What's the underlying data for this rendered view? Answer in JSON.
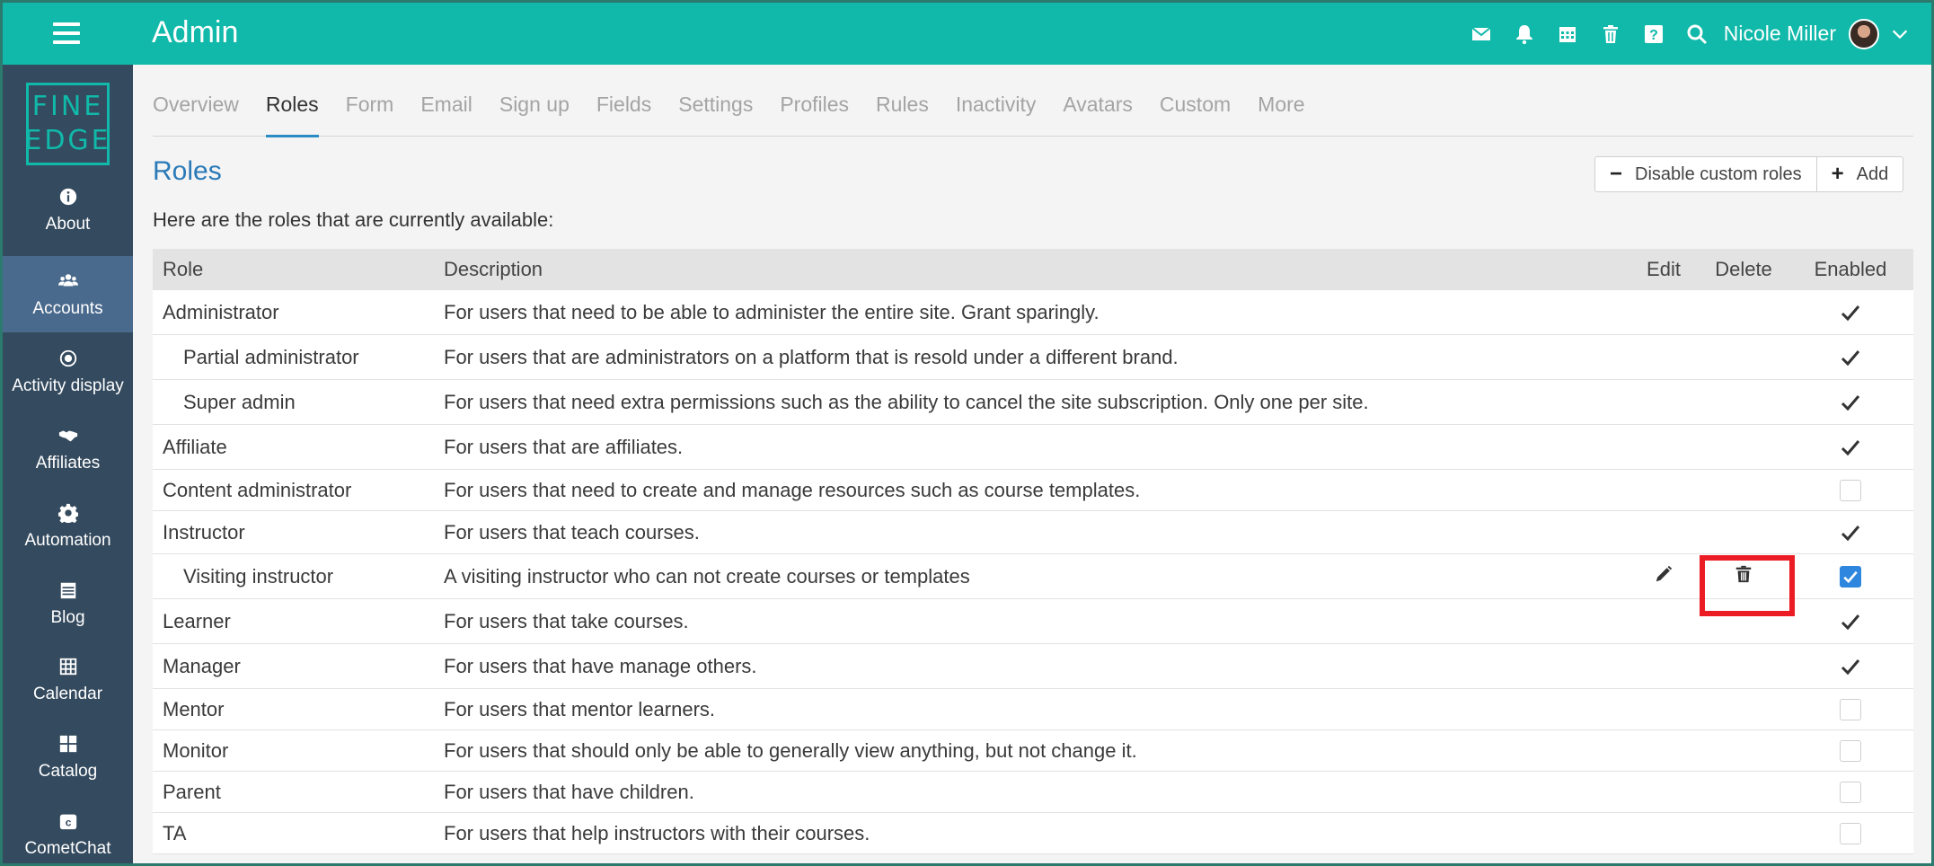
{
  "app": {
    "title": "Admin"
  },
  "topbar": {
    "icons": [
      "mail-icon",
      "bell-icon",
      "calendar-icon",
      "trash-icon",
      "help-icon",
      "search-icon"
    ],
    "user_name": "Nicole Miller"
  },
  "logo": {
    "line1": "FINE",
    "line2": "EDGE"
  },
  "sidebar": {
    "items": [
      {
        "label": "About",
        "icon": "info-icon"
      },
      {
        "label": "Accounts",
        "icon": "users-icon",
        "active": true
      },
      {
        "label": "Activity display",
        "icon": "dot-circle-icon"
      },
      {
        "label": "Affiliates",
        "icon": "handshake-icon"
      },
      {
        "label": "Automation",
        "icon": "gear-icon"
      },
      {
        "label": "Blog",
        "icon": "blog-icon"
      },
      {
        "label": "Calendar",
        "icon": "calendar-grid-icon"
      },
      {
        "label": "Catalog",
        "icon": "grid-icon"
      },
      {
        "label": "CometChat",
        "icon": "cometchat-icon"
      }
    ]
  },
  "tabs": [
    "Overview",
    "Roles",
    "Form",
    "Email",
    "Sign up",
    "Fields",
    "Settings",
    "Profiles",
    "Rules",
    "Inactivity",
    "Avatars",
    "Custom",
    "More"
  ],
  "active_tab": "Roles",
  "section": {
    "title": "Roles",
    "disable_button": "Disable custom roles",
    "add_button": "Add",
    "intro": "Here are the roles that are currently available:"
  },
  "table": {
    "headers": {
      "role": "Role",
      "description": "Description",
      "edit": "Edit",
      "delete": "Delete",
      "enabled": "Enabled"
    },
    "rows": [
      {
        "role": "Administrator",
        "description": "For users that need to be able to administer the entire site. Grant sparingly.",
        "indent": false,
        "enabled": "check"
      },
      {
        "role": "Partial administrator",
        "description": "For users that are administrators on a platform that is resold under a different brand.",
        "indent": true,
        "enabled": "check"
      },
      {
        "role": "Super admin",
        "description": "For users that need extra permissions such as the ability to cancel the site subscription. Only one per site.",
        "indent": true,
        "enabled": "check"
      },
      {
        "role": "Affiliate",
        "description": "For users that are affiliates.",
        "indent": false,
        "enabled": "check"
      },
      {
        "role": "Content administrator",
        "description": "For users that need to create and manage resources such as course templates.",
        "indent": false,
        "enabled": "box"
      },
      {
        "role": "Instructor",
        "description": "For users that teach courses.",
        "indent": false,
        "enabled": "check"
      },
      {
        "role": "Visiting instructor",
        "description": "A visiting instructor who can not create courses or templates",
        "indent": true,
        "enabled": "checked-box",
        "editable": true,
        "highlighted_delete": true
      },
      {
        "role": "Learner",
        "description": "For users that take courses.",
        "indent": false,
        "enabled": "check"
      },
      {
        "role": "Manager",
        "description": "For users that have manage others.",
        "indent": false,
        "enabled": "check"
      },
      {
        "role": "Mentor",
        "description": "For users that mentor learners.",
        "indent": false,
        "enabled": "box"
      },
      {
        "role": "Monitor",
        "description": "For users that should only be able to generally view anything, but not change it.",
        "indent": false,
        "enabled": "box"
      },
      {
        "role": "Parent",
        "description": "For users that have children.",
        "indent": false,
        "enabled": "box"
      },
      {
        "role": "TA",
        "description": "For users that help instructors with their courses.",
        "indent": false,
        "enabled": "box"
      }
    ]
  },
  "colors": {
    "topbar": "#10b9a9",
    "sidebar": "#344a5e",
    "sidebar_active": "#4a6a8d",
    "accent": "#2a7ab8",
    "highlight": "#ec1c24",
    "checkbox_checked": "#2e86de"
  }
}
